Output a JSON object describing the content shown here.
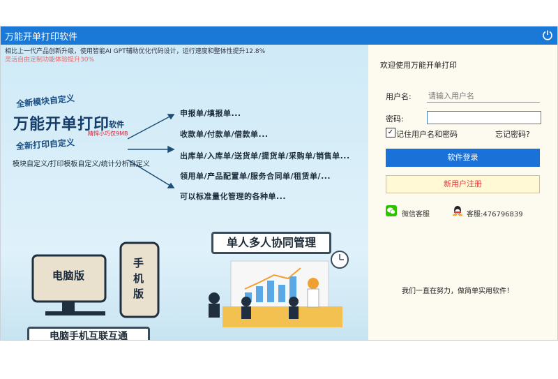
{
  "window": {
    "title": "万能开单打印软件"
  },
  "notices": {
    "line1": "相比上一代产品创新升级，使用智能AI GPT辅助优化代码设计，运行速度和整体性提升12.8%",
    "line2": "灵活自由定制功能体验提升30%"
  },
  "promo": {
    "brand_top": "全新模块自定义",
    "brand_main": "万能开单打印",
    "brand_suffix": "软件",
    "brand_small": "精悍小巧仅9MB",
    "brand_bottom": "全新打印自定义",
    "features": "模块自定义/打印模板自定义/统计分析自定义",
    "items": [
      "申报单/填报单...",
      "收款单/付款单/借款单...",
      "出库单/入库单/送货单/提货单/采购单/销售单...",
      "领用单/产品配置单/服务合同单/租赁单/...",
      "可以标准量化管理的各种单..."
    ],
    "banner_collab": "单人多人协同管理",
    "banner_link": "电脑手机互联互通",
    "pc_label": "电脑版",
    "phone_label": "手机版"
  },
  "login": {
    "welcome": "欢迎使用万能开单打印",
    "username_label": "用户名:",
    "username_placeholder": "请输入用户名",
    "username_value": "",
    "password_label": "密码:",
    "password_value": "",
    "remember_label": "记住用户名和密码",
    "remember_checked": true,
    "forgot_label": "忘记密码?",
    "login_button": "软件登录",
    "register_button": "新用户注册",
    "wechat_service": "微信客服",
    "qq_service": "客服:476796839",
    "footer": "我们一直在努力，做简单实用软件！"
  },
  "icons": {
    "power": "power-icon",
    "wechat": "wechat-icon",
    "qq": "qq-icon",
    "check": "checkmark-icon"
  },
  "colors": {
    "titlebar": "#1a78d6",
    "login_button": "#1a72d8",
    "register_text": "#e03c3c",
    "notice_highlight": "#e46b6b"
  }
}
